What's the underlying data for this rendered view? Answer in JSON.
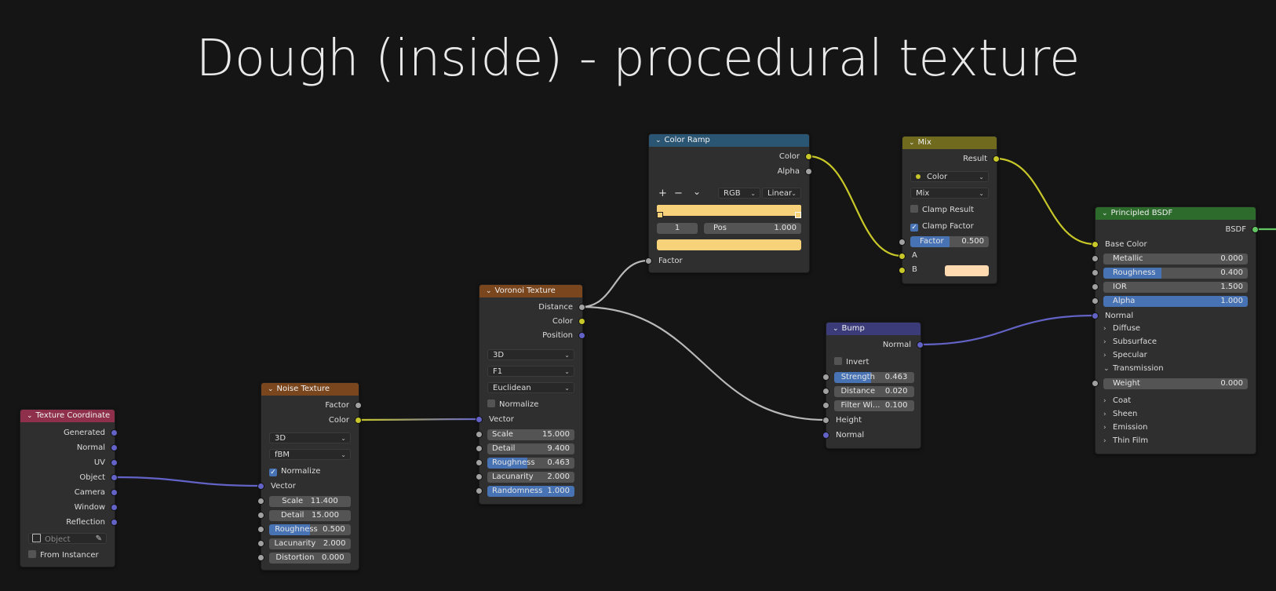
{
  "title": "Dough (inside) - procedural texture",
  "colors": {
    "background": "#151515",
    "node_body": "#2f2f2f",
    "header_input": "#8e2f4b",
    "header_texture": "#79461d",
    "header_converter": "#2b5673",
    "header_mix": "#6f6a1e",
    "header_vector": "#3b3b7a",
    "header_shader": "#2c6b2c",
    "socket_color": "#c7c729",
    "socket_gray": "#a1a1a1",
    "socket_vector": "#6363c7",
    "socket_shader": "#63c763",
    "slider_fill": "#4772b3"
  },
  "texture_coordinate": {
    "header": "Texture Coordinate",
    "outputs": [
      "Generated",
      "Normal",
      "UV",
      "Object",
      "Camera",
      "Window",
      "Reflection"
    ],
    "object_placeholder": "Object",
    "from_instancer": "From Instancer"
  },
  "noise": {
    "header": "Noise Texture",
    "outputs": [
      "Factor",
      "Color"
    ],
    "dim": "3D",
    "type": "fBM",
    "normalize": "Normalize",
    "vector": "Vector",
    "fields": [
      {
        "label": "Scale",
        "value": "11.400",
        "fill": 0
      },
      {
        "label": "Detail",
        "value": "15.000",
        "fill": 0
      },
      {
        "label": "Roughness",
        "value": "0.500",
        "fill": 0.5
      },
      {
        "label": "Lacunarity",
        "value": "2.000",
        "fill": 0
      },
      {
        "label": "Distortion",
        "value": "0.000",
        "fill": 0
      }
    ]
  },
  "voronoi": {
    "header": "Voronoi Texture",
    "outputs": [
      "Distance",
      "Color",
      "Position"
    ],
    "dim": "3D",
    "feature": "F1",
    "metric": "Euclidean",
    "normalize": "Normalize",
    "vector": "Vector",
    "fields": [
      {
        "label": "Scale",
        "value": "15.000",
        "fill": 0
      },
      {
        "label": "Detail",
        "value": "9.400",
        "fill": 0
      },
      {
        "label": "Roughness",
        "value": "0.463",
        "fill": 0.463
      },
      {
        "label": "Lacunarity",
        "value": "2.000",
        "fill": 0
      },
      {
        "label": "Randomness",
        "value": "1.000",
        "fill": 1
      }
    ]
  },
  "color_ramp": {
    "header": "Color Ramp",
    "outputs": [
      "Color",
      "Alpha"
    ],
    "plus": "+",
    "minus": "−",
    "menu": "⌄",
    "mode": "RGB",
    "interp": "Linear",
    "stop_index": "1",
    "pos_label": "Pos",
    "pos_value": "1.000",
    "ramp_color": "#f7d27a",
    "input": "Factor"
  },
  "mix": {
    "header": "Mix",
    "outputs": [
      "Result"
    ],
    "data_type": "Color",
    "blend": "Mix",
    "clamp_result": "Clamp Result",
    "clamp_factor": "Clamp Factor",
    "factor_label": "Factor",
    "factor_value": "0.500",
    "factor_fill": 0.5,
    "input_a": "A",
    "input_b": "B",
    "b_color": "#ffd9b0"
  },
  "bump": {
    "header": "Bump",
    "outputs": [
      "Normal"
    ],
    "invert": "Invert",
    "fields": [
      {
        "label": "Strength",
        "value": "0.463",
        "fill": 0.463
      },
      {
        "label": "Distance",
        "value": "0.020",
        "fill": 0
      },
      {
        "label": "Filter Wi...",
        "value": "0.100",
        "fill": 0
      }
    ],
    "height": "Height",
    "normal": "Normal"
  },
  "bsdf": {
    "header": "Principled BSDF",
    "outputs": [
      "BSDF"
    ],
    "base_color": "Base Color",
    "fields": [
      {
        "label": "Metallic",
        "value": "0.000",
        "fill": 0
      },
      {
        "label": "Roughness",
        "value": "0.400",
        "fill": 0.4
      },
      {
        "label": "IOR",
        "value": "1.500",
        "fill": 0
      },
      {
        "label": "Alpha",
        "value": "1.000",
        "fill": 1
      }
    ],
    "normal": "Normal",
    "panels_a": [
      {
        "label": "Diffuse",
        "open": false
      },
      {
        "label": "Subsurface",
        "open": false
      },
      {
        "label": "Specular",
        "open": false
      },
      {
        "label": "Transmission",
        "open": true
      }
    ],
    "weight": {
      "label": "Weight",
      "value": "0.000"
    },
    "panels_b": [
      "Coat",
      "Sheen",
      "Emission",
      "Thin Film"
    ]
  }
}
